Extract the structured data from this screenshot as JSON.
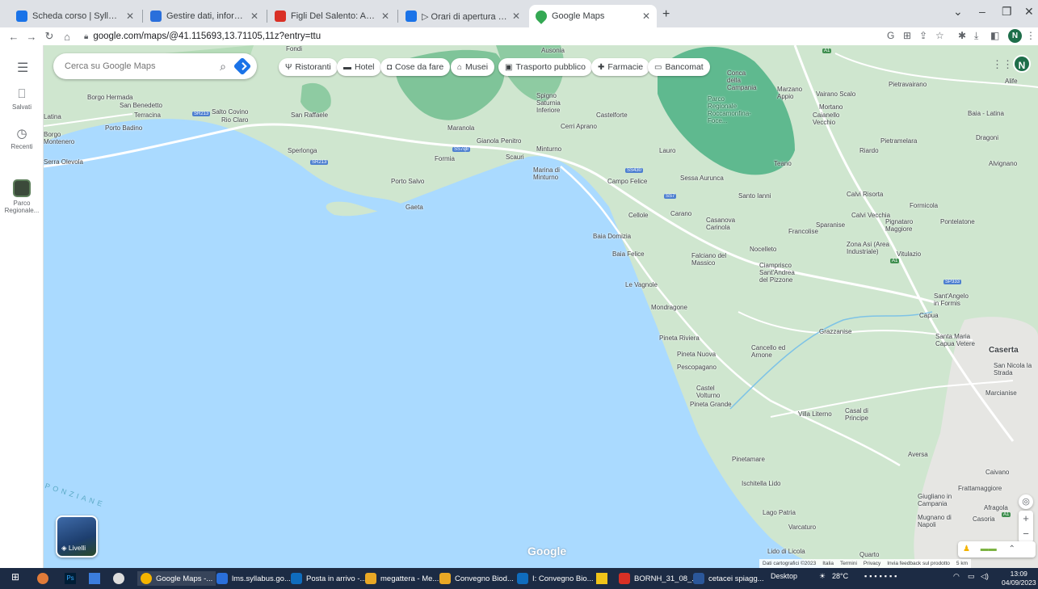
{
  "browser": {
    "tabs": [
      {
        "title": "Scheda corso | Syllabus",
        "color": "#1a73e8"
      },
      {
        "title": "Gestire dati, informazioni e conte",
        "color": "#2a6fdb"
      },
      {
        "title": "Figli Del Salento: Achille Costa -",
        "color": "#d93025"
      },
      {
        "title": "▷ Orari di apertura ,Diocesi di C",
        "color": "#1a73e8"
      },
      {
        "title": "Google Maps",
        "color": "#34a853"
      }
    ],
    "url": "google.com/maps/@41.115693,13.71105,11z?entry=ttu",
    "profile_initial": "N"
  },
  "rail": {
    "saved_label": "Salvati",
    "recent_label": "Recenti",
    "recent_place_label": "Parco Regionale..."
  },
  "search": {
    "placeholder": "Cerca su Google Maps"
  },
  "chips": [
    {
      "icon": "Ψ",
      "label": "Ristoranti"
    },
    {
      "icon": "▬",
      "label": "Hotel"
    },
    {
      "icon": "◘",
      "label": "Cose da fare"
    },
    {
      "icon": "⌂",
      "label": "Musei"
    },
    {
      "icon": "▣",
      "label": "Trasporto pubblico"
    },
    {
      "icon": "✚",
      "label": "Farmacie"
    },
    {
      "icon": "▭",
      "label": "Bancomat"
    }
  ],
  "map": {
    "layers_label": "Livelli",
    "google_logo": "Google",
    "sea_label": "PONZIANE",
    "footer": [
      "Dati cartografici ©2023",
      "Italia",
      "Termini",
      "Privacy",
      "Invia feedback sul prodotto",
      "5 km"
    ],
    "places": [
      {
        "name": "Fondi"
      },
      {
        "name": "Ausonia"
      },
      {
        "name": "Borgo Hermada"
      },
      {
        "name": "San Benedetto"
      },
      {
        "name": "Terracina"
      },
      {
        "name": "Salto Covino"
      },
      {
        "name": "Rio Claro"
      },
      {
        "name": "Porto Badino"
      },
      {
        "name": "San Raffaele"
      },
      {
        "name": "Sperlonga"
      },
      {
        "name": "Porto Salvo"
      },
      {
        "name": "Gaeta"
      },
      {
        "name": "Formia"
      },
      {
        "name": "Maranola"
      },
      {
        "name": "Penitro"
      },
      {
        "name": "Scauri"
      },
      {
        "name": "Minturno"
      },
      {
        "name": "Marina di Minturno"
      },
      {
        "name": "Spigno Saturnia Inferiore"
      },
      {
        "name": "Castelforte"
      },
      {
        "name": "Cerri Aprano"
      },
      {
        "name": "Lauro"
      },
      {
        "name": "Campo Felice"
      },
      {
        "name": "Sessa Aurunca"
      },
      {
        "name": "Cellole"
      },
      {
        "name": "Carano"
      },
      {
        "name": "Baia Domizia"
      },
      {
        "name": "Baia Felice"
      },
      {
        "name": "Casanova Carinola"
      },
      {
        "name": "Falciano del Massico"
      },
      {
        "name": "Nocelleto"
      },
      {
        "name": "Santo Ianni"
      },
      {
        "name": "Francolise"
      },
      {
        "name": "Sparanise"
      },
      {
        "name": "Calvi Risorta"
      },
      {
        "name": "Teano"
      },
      {
        "name": "Riardo"
      },
      {
        "name": "Pietramelara"
      },
      {
        "name": "Marzano Appio"
      },
      {
        "name": "Vairano Scalo"
      },
      {
        "name": "Pietravairano"
      },
      {
        "name": "Alife"
      },
      {
        "name": "Baia - Latina"
      },
      {
        "name": "Dragoni"
      },
      {
        "name": "Alvignano"
      },
      {
        "name": "Formicola"
      },
      {
        "name": "Pontelatone"
      },
      {
        "name": "Pignataro Maggiore"
      },
      {
        "name": "Vitulazio"
      },
      {
        "name": "Le Vagnole"
      },
      {
        "name": "Mondragone"
      },
      {
        "name": "Cancello ed Arnone"
      },
      {
        "name": "Grazzanise"
      },
      {
        "name": "Capua"
      },
      {
        "name": "Sant'Angelo in Formis"
      },
      {
        "name": "Santa Maria Capua Vetere"
      },
      {
        "name": "Caserta"
      },
      {
        "name": "San Nicola la Strada"
      },
      {
        "name": "Marcianise"
      },
      {
        "name": "Pineta Riviera"
      },
      {
        "name": "Pineta Nuova"
      },
      {
        "name": "Pescopagano"
      },
      {
        "name": "Castel Volturno"
      },
      {
        "name": "Pineta Grande"
      },
      {
        "name": "Villa Literno"
      },
      {
        "name": "Casal di Principe"
      },
      {
        "name": "Aversa"
      },
      {
        "name": "Pinetamare"
      },
      {
        "name": "Ischitella Lido"
      },
      {
        "name": "Lago Patria"
      },
      {
        "name": "Varcaturo"
      },
      {
        "name": "Giugliano in Campania"
      },
      {
        "name": "Mugnano di Napoli"
      },
      {
        "name": "Casoria"
      },
      {
        "name": "Frattamaggiore"
      },
      {
        "name": "Afragola"
      },
      {
        "name": "Caivano"
      },
      {
        "name": "Lido di Licola"
      },
      {
        "name": "Quarto"
      },
      {
        "name": "Parco Regionale Roccamonfina-Foce..."
      },
      {
        "name": "Conca della Campania"
      },
      {
        "name": "Mortano"
      },
      {
        "name": "Caianello Vecchio"
      },
      {
        "name": "Ciamprisco Sant'Andrea del Pizzone"
      },
      {
        "name": "Zona Asi (Area Industriale)"
      },
      {
        "name": "Calvi Vecchia"
      },
      {
        "name": "Serra Olevola"
      },
      {
        "name": "Borgo Montenero"
      },
      {
        "name": "Latina"
      },
      {
        "name": "Gianola"
      }
    ]
  },
  "taskbar": {
    "items": [
      {
        "label": "Google Maps -...",
        "color": "#f4b400"
      },
      {
        "label": "lms.syllabus.go...",
        "color": "#2a6fdb"
      },
      {
        "label": "Posta in arrivo -...",
        "color": "#0f6cbd"
      },
      {
        "label": "megattera - Me...",
        "color": "#e9a825"
      },
      {
        "label": "Convegno Biod...",
        "color": "#e9a825"
      },
      {
        "label": "I: Convegno Bio...",
        "color": "#0f6cbd"
      },
      {
        "label": "BORNH_31_08_...",
        "color": "#d93025"
      },
      {
        "label": "cetacei spiagg...",
        "color": "#2b579a"
      }
    ],
    "desktop_label": "Desktop",
    "temperature": "28°C",
    "time": "13:09",
    "date": "04/09/2023"
  },
  "colors": {
    "sea": "#aadaff",
    "land": "#cfe6cf",
    "park": "#5fb98f",
    "road": "#ffffff",
    "accent": "#1a73e8"
  }
}
